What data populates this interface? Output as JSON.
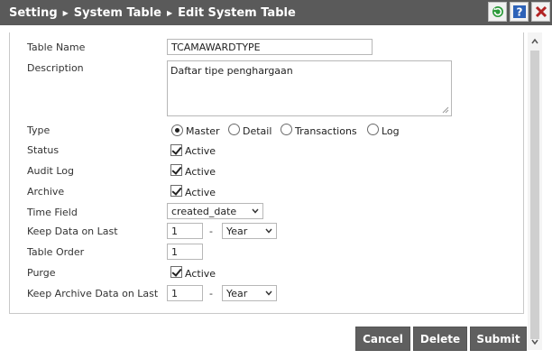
{
  "header": {
    "breadcrumbs": [
      "Setting",
      "System Table",
      "Edit System Table"
    ],
    "icons": [
      "refresh-icon",
      "help-icon",
      "close-icon"
    ]
  },
  "form": {
    "table_name": {
      "label": "Table Name",
      "value": "TCAMAWARDTYPE"
    },
    "description": {
      "label": "Description",
      "value": "Daftar tipe penghargaan"
    },
    "type": {
      "label": "Type",
      "options": [
        "Master",
        "Detail",
        "Transactions",
        "Log"
      ],
      "selected": "Master"
    },
    "status": {
      "label": "Status",
      "check_label": "Active",
      "checked": true
    },
    "audit_log": {
      "label": "Audit Log",
      "check_label": "Active",
      "checked": true
    },
    "archive": {
      "label": "Archive",
      "check_label": "Active",
      "checked": true
    },
    "time_field": {
      "label": "Time Field",
      "value": "created_date"
    },
    "keep_data": {
      "label": "Keep Data on Last",
      "value": "1",
      "dash": "-",
      "unit": "Year"
    },
    "table_order": {
      "label": "Table Order",
      "value": "1"
    },
    "purge": {
      "label": "Purge",
      "check_label": "Active",
      "checked": true
    },
    "keep_archive": {
      "label": "Keep Archive Data on Last",
      "value": "1",
      "dash": "-",
      "unit": "Year"
    }
  },
  "buttons": {
    "cancel": "Cancel",
    "delete": "Delete",
    "submit": "Submit"
  }
}
